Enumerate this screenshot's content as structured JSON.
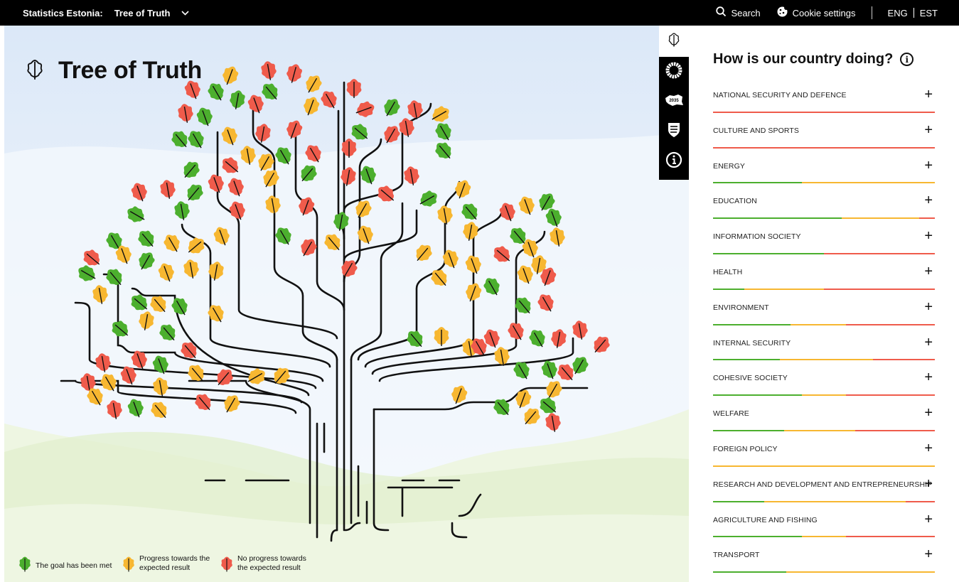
{
  "topbar": {
    "brand": "Statistics Estonia:",
    "app_name": "Tree of Truth",
    "search_label": "Search",
    "cookie_label": "Cookie settings",
    "lang_active": "ENG",
    "lang_other": "EST"
  },
  "page": {
    "title": "Tree of Truth"
  },
  "legend": {
    "met": "The goal has been met",
    "progress": "Progress towards the expected result",
    "none": "No progress towards the expected result"
  },
  "colors": {
    "green": "#4caf2e",
    "orange": "#f7b731",
    "red": "#ef5b4b"
  },
  "icon_bar": [
    "oak-leaf-icon",
    "sdg-wheel-icon",
    "estonia-2035-icon",
    "coat-of-arms-icon",
    "info-icon"
  ],
  "panel": {
    "title": "How is our country doing?",
    "rows": [
      {
        "label": "NATIONAL SECURITY AND DEFENCE",
        "green": 0,
        "orange": 0,
        "red": 1
      },
      {
        "label": "CULTURE AND SPORTS",
        "green": 0,
        "orange": 0,
        "red": 1
      },
      {
        "label": "ENERGY",
        "green": 0.4,
        "orange": 0.6,
        "red": 0
      },
      {
        "label": "EDUCATION",
        "green": 0.58,
        "orange": 0.35,
        "red": 0.07
      },
      {
        "label": "INFORMATION SOCIETY",
        "green": 0.5,
        "orange": 0,
        "red": 0.5
      },
      {
        "label": "HEALTH",
        "green": 0.14,
        "orange": 0.36,
        "red": 0.5
      },
      {
        "label": "ENVIRONMENT",
        "green": 0.35,
        "orange": 0.25,
        "red": 0.4
      },
      {
        "label": "INTERNAL SECURITY",
        "green": 0.3,
        "orange": 0.42,
        "red": 0.28
      },
      {
        "label": "COHESIVE SOCIETY",
        "green": 0.4,
        "orange": 0.2,
        "red": 0.4
      },
      {
        "label": "WELFARE",
        "green": 0.32,
        "orange": 0.32,
        "red": 0.36
      },
      {
        "label": "FOREIGN POLICY",
        "green": 0,
        "orange": 1,
        "red": 0
      },
      {
        "label": "RESEARCH AND DEVELOPMENT AND ENTREPRENEURSHIP",
        "green": 0.23,
        "orange": 0.64,
        "red": 0.13
      },
      {
        "label": "AGRICULTURE AND FISHING",
        "green": 0.4,
        "orange": 0.2,
        "red": 0.4
      },
      {
        "label": "TRANSPORT",
        "green": 0.33,
        "orange": 0.67,
        "red": 0
      }
    ]
  }
}
